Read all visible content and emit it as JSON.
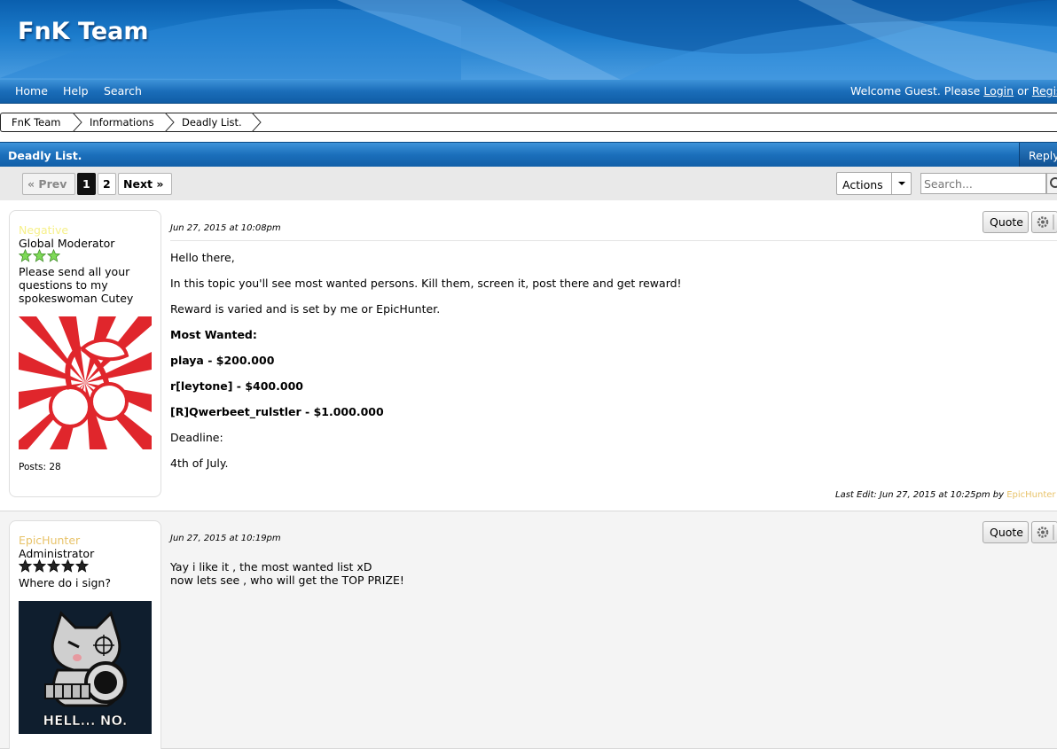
{
  "site": {
    "title": "FnK Team"
  },
  "nav": {
    "items": [
      "Home",
      "Help",
      "Search"
    ],
    "welcome_prefix": "Welcome Guest. Please ",
    "login": "Login",
    "or": " or ",
    "register": "Register"
  },
  "breadcrumb": [
    "FnK Team",
    "Informations",
    "Deadly List."
  ],
  "thread": {
    "title": "Deadly List.",
    "reply": "Reply"
  },
  "pagination": {
    "prev": "« Prev",
    "pages": [
      "1",
      "2"
    ],
    "current": "1",
    "next": "Next »"
  },
  "toolbar": {
    "actions": "Actions",
    "search_placeholder": "Search..."
  },
  "posts": [
    {
      "username": "Negative",
      "username_color": "#f6f08a",
      "role": "Global Moderator",
      "stars": 3,
      "star_color": "#7ed957",
      "usertext": "Please send all your questions to my spokeswoman Cutey",
      "avatar": "cherry-sunburst",
      "postcount": "Posts: 28",
      "date": "Jun 27, 2015 at 10:08pm",
      "quote": "Quote",
      "body": [
        "Hello there,",
        "In this topic you'll see most wanted persons. Kill them, screen it, post there and get reward!",
        "Reward is varied and is set by me or EpicHunter.",
        "Most Wanted:",
        "playa - $200.000",
        "r[leytone] - $400.000",
        "[R]Qwerbeet_rulstler - $1.000.000",
        "Deadline:",
        "4th of July."
      ],
      "bold_lines": [
        3,
        4,
        5,
        6
      ],
      "edit_prefix": "Last Edit: Jun 27, 2015 at 10:25pm by ",
      "edit_user": "EpicHunter"
    },
    {
      "username": "EpicHunter",
      "username_color": "#e8c36a",
      "role": "Administrator",
      "stars": 5,
      "star_color": "#222222",
      "usertext": "Where do i sign?",
      "avatar": "cat-with-gun",
      "avatar_caption": "HELL... NO.",
      "date": "Jun 27, 2015 at 10:19pm",
      "quote": "Quote",
      "body": [
        "Yay i like it , the most wanted list xD",
        "now lets see , who will get the TOP PRIZE!"
      ]
    }
  ]
}
